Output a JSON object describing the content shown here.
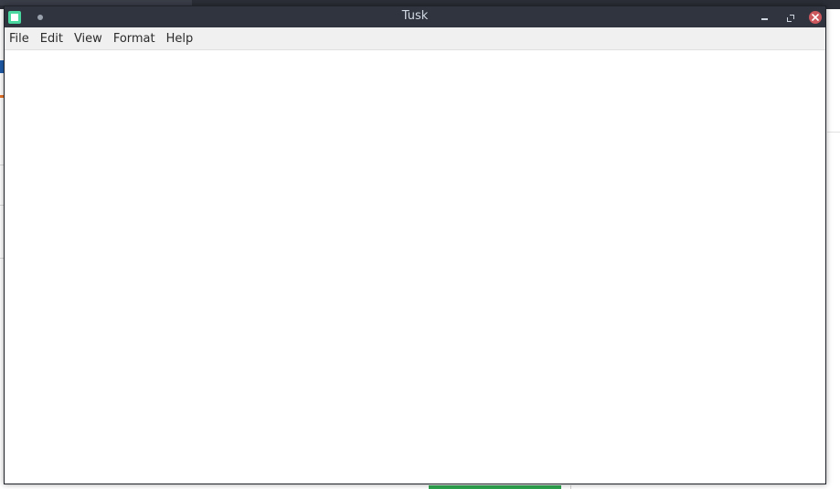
{
  "window": {
    "title": "Tusk"
  },
  "menu": {
    "items": [
      "File",
      "Edit",
      "View",
      "Format",
      "Help"
    ]
  },
  "colors": {
    "titlebar": "#2f343f",
    "app_icon": "#4ad7a0",
    "close_button": "#cc575d",
    "menubar": "#f0f0f0"
  },
  "icons": {
    "app": "tusk-app-icon",
    "sticky": "sticky-dot-icon",
    "minimize": "minimize-icon",
    "maximize": "maximize-icon",
    "close": "close-icon"
  }
}
